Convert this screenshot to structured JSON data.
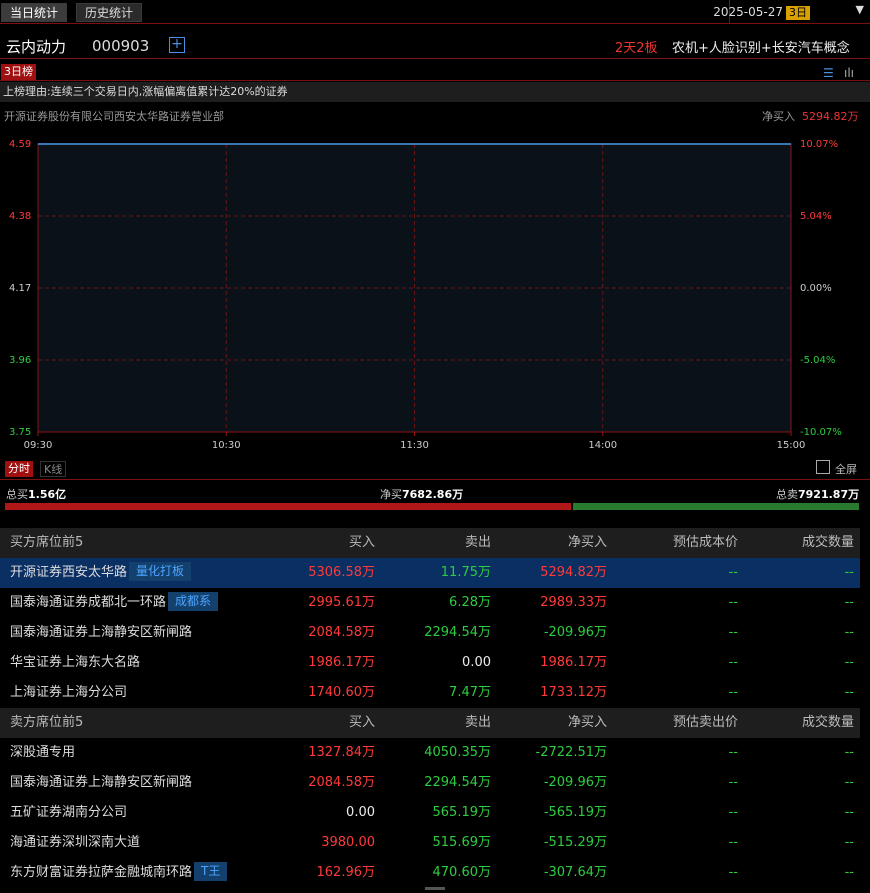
{
  "tabs": [
    {
      "label": "当日统计",
      "active": true
    },
    {
      "label": "历史统计",
      "active": false
    }
  ],
  "date": {
    "value": "2025-05-27",
    "period": "3日"
  },
  "stock": {
    "name": "云内动力",
    "code": "000903",
    "limit": "2天2板",
    "concept": "农机+人脸识别+长安汽车概念"
  },
  "rank_tag": "3日榜",
  "reason": "上榜理由:连续三个交易日内,涨幅偏离值累计达20%的证券",
  "featured": {
    "broker": "开源证券股份有限公司西安太华路证券营业部",
    "net_label": "净买入",
    "net_value": "5294.82万"
  },
  "chart_data": {
    "type": "line",
    "x": [
      "09:30",
      "15:00"
    ],
    "values": [
      4.59,
      4.59
    ],
    "xticks": [
      "09:30",
      "10:30",
      "11:30",
      "14:00",
      "15:00"
    ],
    "yticks_left": [
      "4.59",
      "4.38",
      "4.17",
      "3.96",
      "3.75"
    ],
    "yticks_right": [
      "10.07%",
      "5.04%",
      "0.00%",
      "-5.04%",
      "-10.07%"
    ],
    "ylim": [
      3.75,
      4.59
    ],
    "grid": true
  },
  "chart_tabs": {
    "fenshi": "分时",
    "kline": "K线",
    "fullscreen": "全屏"
  },
  "totals": {
    "buy_label": "总买",
    "buy_value": "1.56亿",
    "net_label": "净买",
    "net_value": "7682.86万",
    "sell_label": "总卖",
    "sell_value": "7921.87万",
    "buy_share": 0.663
  },
  "buy_table": {
    "headers": [
      "买方席位前5",
      "买入",
      "卖出",
      "净买入",
      "预估成本价",
      "成交数量"
    ],
    "rows": [
      {
        "name": "开源证券西安太华路",
        "tag": "量化打板",
        "buy": "5306.58万",
        "sell": "11.75万",
        "net": "5294.82万",
        "cost": "--",
        "vol": "--",
        "selected": true
      },
      {
        "name": "国泰海通证券成都北一环路",
        "tag": "成都系",
        "buy": "2995.61万",
        "sell": "6.28万",
        "net": "2989.33万",
        "cost": "--",
        "vol": "--"
      },
      {
        "name": "国泰海通证券上海静安区新闸路",
        "tag": "",
        "buy": "2084.58万",
        "sell": "2294.54万",
        "net": "-209.96万",
        "cost": "--",
        "vol": "--"
      },
      {
        "name": "华宝证券上海东大名路",
        "tag": "",
        "buy": "1986.17万",
        "sell": "0.00",
        "net": "1986.17万",
        "cost": "--",
        "vol": "--"
      },
      {
        "name": "上海证券上海分公司",
        "tag": "",
        "buy": "1740.60万",
        "sell": "7.47万",
        "net": "1733.12万",
        "cost": "--",
        "vol": "--"
      }
    ]
  },
  "sell_table": {
    "headers": [
      "卖方席位前5",
      "买入",
      "卖出",
      "净买入",
      "预估卖出价",
      "成交数量"
    ],
    "rows": [
      {
        "name": "深股通专用",
        "tag": "",
        "buy": "1327.84万",
        "sell": "4050.35万",
        "net": "-2722.51万",
        "cost": "--",
        "vol": "--"
      },
      {
        "name": "国泰海通证券上海静安区新闸路",
        "tag": "",
        "buy": "2084.58万",
        "sell": "2294.54万",
        "net": "-209.96万",
        "cost": "--",
        "vol": "--"
      },
      {
        "name": "五矿证券湖南分公司",
        "tag": "",
        "buy": "0.00",
        "sell": "565.19万",
        "net": "-565.19万",
        "cost": "--",
        "vol": "--"
      },
      {
        "name": "海通证券深圳深南大道",
        "tag": "",
        "buy": "3980.00",
        "sell": "515.69万",
        "net": "-515.29万",
        "cost": "--",
        "vol": "--"
      },
      {
        "name": "东方财富证券拉萨金融城南环路",
        "tag": "T王",
        "buy": "162.96万",
        "sell": "470.60万",
        "net": "-307.64万",
        "cost": "--",
        "vol": "--"
      }
    ]
  }
}
